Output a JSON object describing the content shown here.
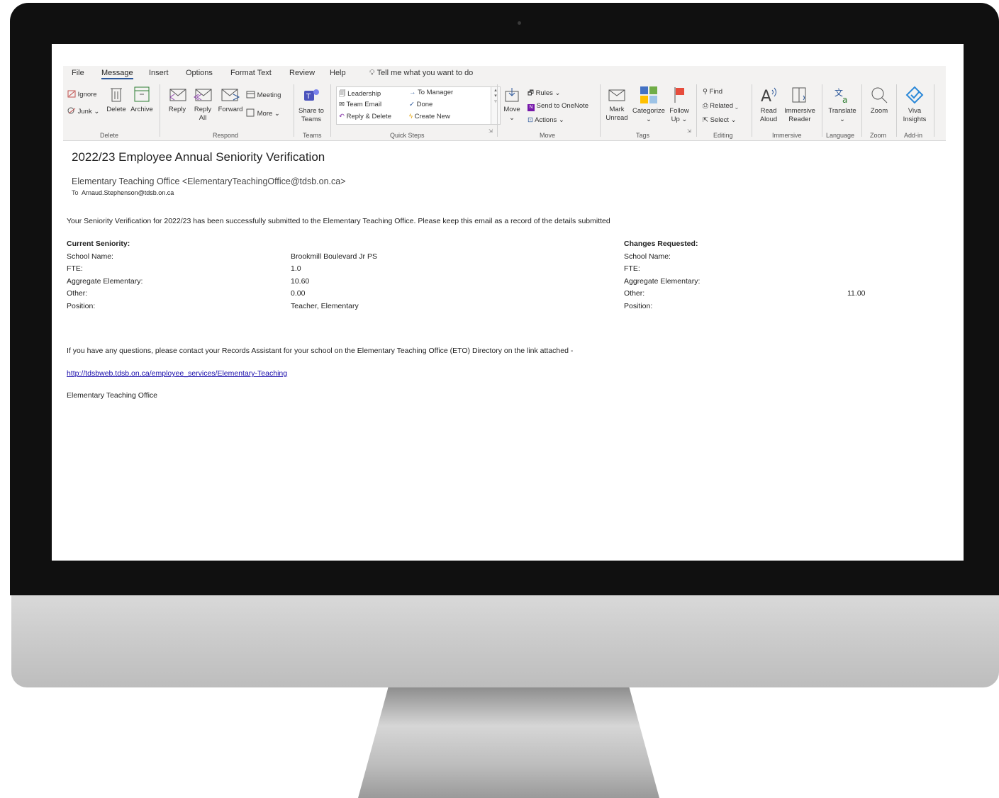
{
  "menu": [
    "File",
    "Message",
    "Insert",
    "Options",
    "Format Text",
    "Review",
    "Help"
  ],
  "tell_me": "Tell me what you want to do",
  "ribbon": {
    "delete": {
      "ignore": "Ignore",
      "junk": "Junk",
      "delete": "Delete",
      "archive": "Archive",
      "label": "Delete"
    },
    "respond": {
      "reply": "Reply",
      "reply_all_1": "Reply",
      "reply_all_2": "All",
      "forward": "Forward",
      "meeting": "Meeting",
      "more": "More",
      "label": "Respond"
    },
    "teams": {
      "share_1": "Share to",
      "share_2": "Teams",
      "label": "Teams"
    },
    "quick_steps": {
      "leadership": "Leadership",
      "team_email": "Team Email",
      "reply_delete": "Reply & Delete",
      "to_manager": "To Manager",
      "done": "Done",
      "create_new": "Create New",
      "label": "Quick Steps"
    },
    "move": {
      "move": "Move",
      "rules": "Rules",
      "onenote": "Send to OneNote",
      "actions": "Actions",
      "label": "Move"
    },
    "tags": {
      "mark_1": "Mark",
      "mark_2": "Unread",
      "categorize": "Categorize",
      "follow_1": "Follow",
      "follow_2": "Up",
      "label": "Tags"
    },
    "editing": {
      "find": "Find",
      "related": "Related",
      "select": "Select",
      "label": "Editing"
    },
    "immersive": {
      "read_1": "Read",
      "read_2": "Aloud",
      "reader_1": "Immersive",
      "reader_2": "Reader",
      "label": "Immersive"
    },
    "language": {
      "translate": "Translate",
      "label": "Language"
    },
    "zoom": {
      "zoom": "Zoom",
      "label": "Zoom"
    },
    "addin": {
      "viva_1": "Viva",
      "viva_2": "Insights",
      "label": "Add-in"
    }
  },
  "email": {
    "subject": "2022/23 Employee Annual Seniority Verification",
    "from": "Elementary Teaching Office <ElementaryTeachingOffice@tdsb.on.ca>",
    "to_label": "To",
    "to": "Arnaud.Stephenson@tdsb.on.ca",
    "intro": "Your Seniority Verification for 2022/23 has been successfully submitted to the Elementary Teaching Office. Please keep this email as a record of the details submitted",
    "current": {
      "heading": "Current Seniority:",
      "rows": [
        {
          "label": "School Name:",
          "value": "Brookmill Boulevard Jr PS"
        },
        {
          "label": "FTE:",
          "value": "1.0"
        },
        {
          "label": "Aggregate Elementary:",
          "value": "10.60"
        },
        {
          "label": "Other:",
          "value": "0.00"
        },
        {
          "label": "Position:",
          "value": "Teacher, Elementary"
        }
      ]
    },
    "changes": {
      "heading": "Changes Requested:",
      "rows": [
        {
          "label": "School Name:",
          "value": ""
        },
        {
          "label": "FTE:",
          "value": ""
        },
        {
          "label": "Aggregate Elementary:",
          "value": ""
        },
        {
          "label": "Other:",
          "value": "11.00"
        },
        {
          "label": "Position:",
          "value": ""
        }
      ]
    },
    "questions": "If you have any questions, please contact your Records Assistant for your school on the Elementary Teaching Office (ETO) Directory on the link attached -",
    "link": "http://tdsbweb.tdsb.on.ca/employee_services/Elementary-Teaching",
    "signature": "Elementary Teaching Office"
  }
}
